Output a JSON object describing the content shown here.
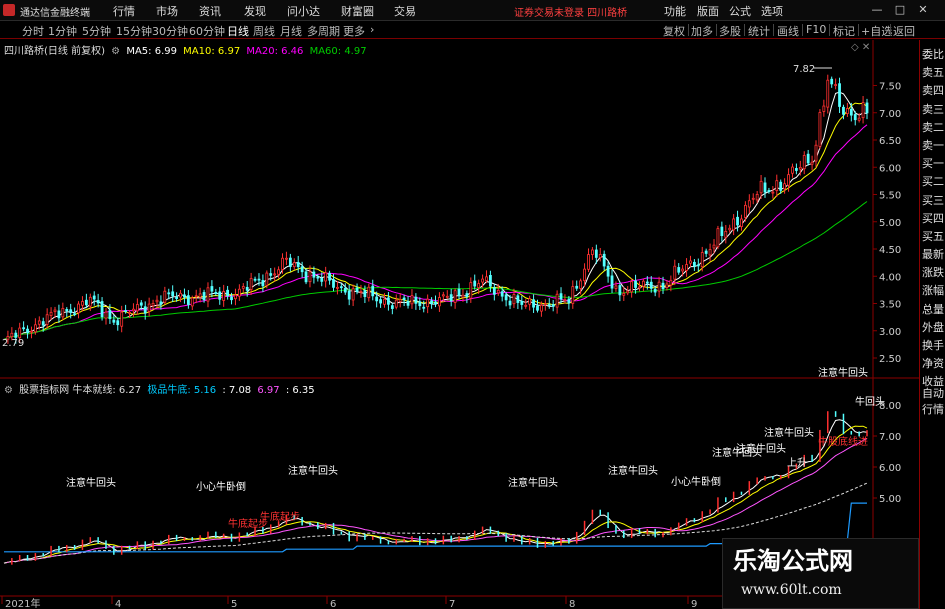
{
  "menubar": {
    "app_title": "通达信金融终端",
    "menus": [
      "行情",
      "市场",
      "资讯",
      "发现",
      "问小达",
      "财富圈",
      "交易"
    ],
    "warning": "证券交易未登录   四川路桥",
    "right_menus": [
      "功能",
      "版面",
      "公式",
      "选项"
    ],
    "window_controls": [
      "—",
      "□",
      "✕"
    ]
  },
  "toolbar": {
    "periods": [
      "分时",
      "1分钟",
      "5分钟",
      "15分钟",
      "30分钟",
      "60分钟",
      "日线",
      "周线",
      "月线",
      "多周期",
      "更多"
    ],
    "active_period": "日线",
    "right_tools": [
      "复权",
      "加多",
      "多股",
      "统计",
      "画线",
      "F10",
      "标记",
      "+自选",
      "返回"
    ]
  },
  "price_panel": {
    "title": "四川路桥(日线 前复权)",
    "ma": [
      {
        "label": "MA5: 6.99",
        "color": "#ffffff"
      },
      {
        "label": "MA10: 6.97",
        "color": "#ffff00"
      },
      {
        "label": "MA20: 6.46",
        "color": "#ff00ff"
      },
      {
        "label": "MA60: 4.97",
        "color": "#00cc00"
      }
    ],
    "y_ticks": [
      "7.50",
      "7.00",
      "6.50",
      "6.00",
      "5.50",
      "5.00",
      "4.50",
      "4.00",
      "3.50",
      "3.00",
      "2.50"
    ],
    "high_label": "7.82",
    "low_label": "2.79"
  },
  "indicator_panel": {
    "title": "股票指标网  牛本就线: 6.27",
    "sub_label": "极品牛底: 5.16",
    "values": [
      {
        "label": ": 7.08",
        "color": "#ffffff"
      },
      {
        "label": "6.97",
        "color": "#ff55ff"
      },
      {
        "label": ": 6.35",
        "color": "#ffffff"
      }
    ],
    "y_ticks": [
      "8.00",
      "7.00",
      "6.00",
      "5.00"
    ],
    "annotations": [
      {
        "text": "注意牛回头",
        "color": "#ffffff"
      },
      {
        "text": "小心牛卧倒",
        "color": "#ffffff"
      },
      {
        "text": "注意牛回头",
        "color": "#ffffff"
      },
      {
        "text": "注意牛回头",
        "color": "#ffffff"
      },
      {
        "text": "注意牛回头",
        "color": "#ffffff"
      },
      {
        "text": "小心牛卧倒",
        "color": "#ffffff"
      },
      {
        "text": "注意牛回头",
        "color": "#ffffff"
      },
      {
        "text": "注意牛回头",
        "color": "#ffffff"
      },
      {
        "text": "注意牛回头",
        "color": "#ffffff"
      },
      {
        "text": "注意牛回头",
        "color": "#ffffff"
      },
      {
        "text": "牛回头",
        "color": "#ffffff"
      },
      {
        "text": "上升",
        "color": "#ffffff"
      },
      {
        "text": "牛底起步",
        "color": "#ff3333"
      },
      {
        "text": "牛底起步",
        "color": "#ff3333"
      },
      {
        "text": "牛股底线进",
        "color": "#ff3333"
      }
    ]
  },
  "date_axis": [
    "2021年",
    "4",
    "5",
    "6",
    "7",
    "8",
    "9"
  ],
  "sidebar": {
    "price_items": [
      "委比",
      "卖五",
      "卖四",
      "卖三",
      "卖二",
      "卖一",
      "买一",
      "买二",
      "买三",
      "买四",
      "买五",
      "最新",
      "涨跌",
      "涨幅",
      "总量",
      "外盘",
      "换手",
      "净资",
      "收益"
    ],
    "indicator_items": [
      "自动",
      "行情"
    ]
  },
  "watermark": {
    "title": "乐淘公式网",
    "url": "www.60lt.com"
  },
  "colors": {
    "up": "#ff3030",
    "down": "#54ffff",
    "ma5": "#ffffff",
    "ma10": "#ffff00",
    "ma20": "#ff00ff",
    "ma60": "#00cc00",
    "frame": "#8b0000"
  }
}
